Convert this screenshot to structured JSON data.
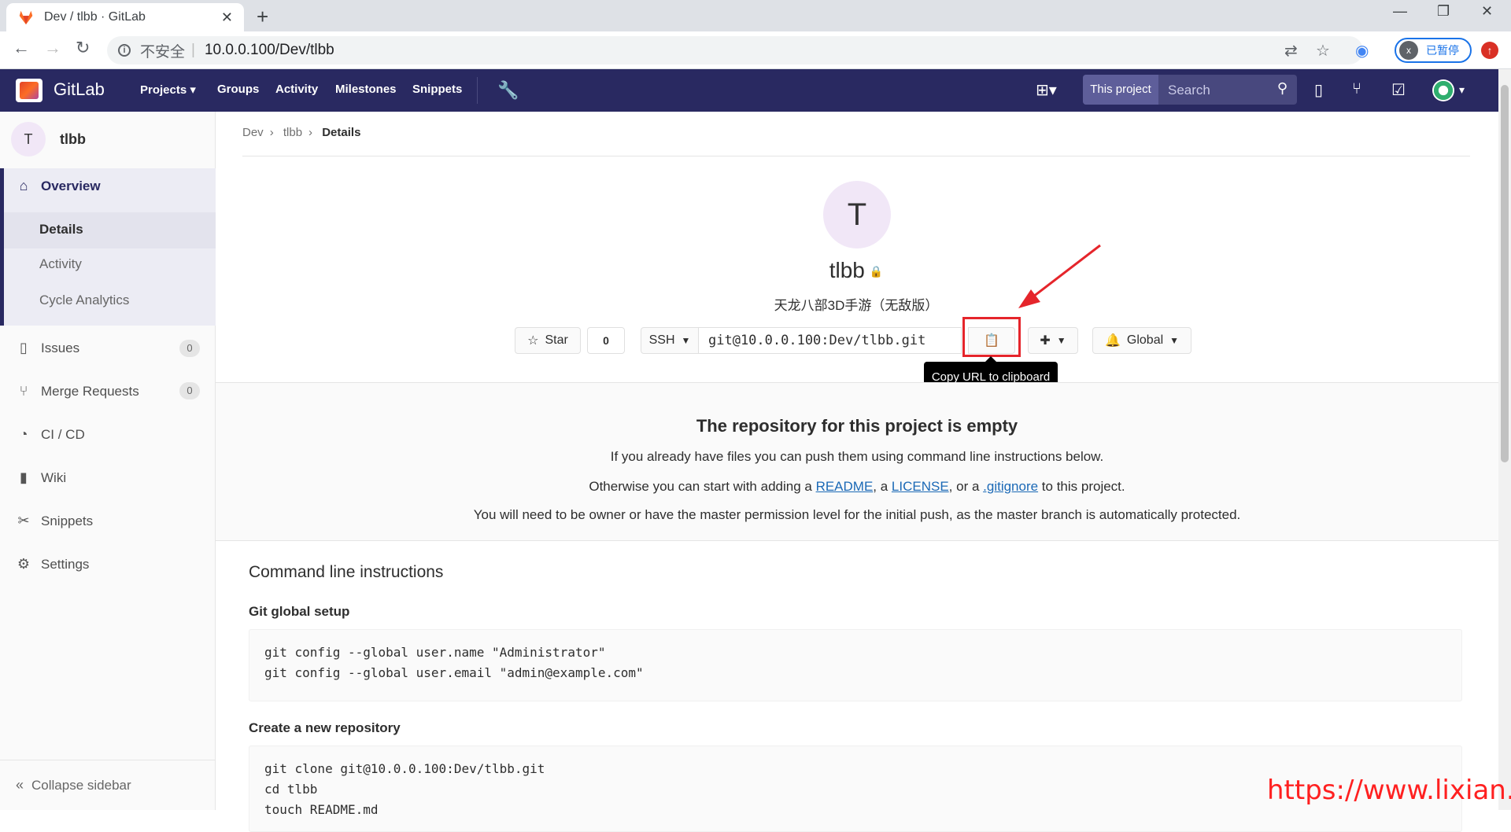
{
  "browser": {
    "tab_title": "Dev / tlbb · GitLab",
    "insecure_label": "不安全",
    "url": "10.0.0.100/Dev/tlbb",
    "profile_initial": "x",
    "paused_label": "已暂停"
  },
  "header": {
    "brand": "GitLab",
    "nav": [
      "Projects",
      "Groups",
      "Activity",
      "Milestones",
      "Snippets"
    ],
    "search_scope": "This project",
    "search_placeholder": "Search"
  },
  "sidebar": {
    "project_initial": "T",
    "project_name": "tlbb",
    "overview": "Overview",
    "sub_items": [
      "Details",
      "Activity",
      "Cycle Analytics"
    ],
    "issues": "Issues",
    "issues_count": "0",
    "merge_requests": "Merge Requests",
    "mr_count": "0",
    "cicd": "CI / CD",
    "wiki": "Wiki",
    "snippets": "Snippets",
    "settings": "Settings",
    "collapse": "Collapse sidebar"
  },
  "breadcrumb": [
    "Dev",
    "tlbb",
    "Details"
  ],
  "project": {
    "initial": "T",
    "name": "tlbb",
    "description": "天龙八部3D手游（无敌版）",
    "star_label": "Star",
    "star_count": "0",
    "protocol": "SSH",
    "clone_url": "git@10.0.0.100:Dev/tlbb.git",
    "notification": "Global",
    "tooltip": "Copy URL to clipboard"
  },
  "empty": {
    "title": "The repository for this project is empty",
    "line1": "If you already have files you can push them using command line instructions below.",
    "line2_prefix": "Otherwise you can start with adding a ",
    "readme": "README",
    "comma": ", a ",
    "license": "LICENSE",
    "or": ", or a ",
    "gitignore": ".gitignore",
    "line2_suffix": " to this project.",
    "line3": "You will need to be owner or have the master permission level for the initial push, as the master branch is automatically protected."
  },
  "cli": {
    "title": "Command line instructions",
    "global_setup": "Git global setup",
    "global_code": "git config --global user.name \"Administrator\"\ngit config --global user.email \"admin@example.com\"",
    "new_repo": "Create a new repository",
    "new_repo_code": "git clone git@10.0.0.100:Dev/tlbb.git\ncd tlbb\ntouch README.md"
  },
  "watermark": "https://www.lixian.fun",
  "colors": {
    "header_bg": "#292961",
    "highlight": "#e5252b",
    "link": "#1b69b6"
  }
}
